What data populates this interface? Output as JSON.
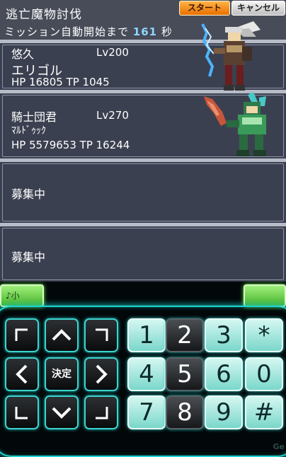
{
  "header": {
    "title": "逃亡魔物討伐",
    "countdown_prefix": "ミッション自動開始まで",
    "countdown_value": "161",
    "countdown_suffix": "秒",
    "start_label": "スタート",
    "cancel_label": "キャンセル"
  },
  "party": [
    {
      "team": "悠久",
      "name": "エリゴル",
      "level": "Lv200",
      "stats": "HP 16805  TP 1045"
    },
    {
      "team": "騎士団君",
      "name": "ﾏﾙﾄﾞｩｯｸ",
      "level": "Lv270",
      "stats": "HP 5579653  TP 16244"
    }
  ],
  "recruiting": [
    {
      "status": "募集中"
    },
    {
      "status": "募集中"
    }
  ],
  "tabs": {
    "left_label": "♪小",
    "right_label": ""
  },
  "dpad": {
    "center_label": "決定"
  },
  "keypad": [
    "1",
    "2",
    "3",
    "*",
    "4",
    "5",
    "6",
    "0",
    "7",
    "8",
    "9",
    "#"
  ],
  "watermark": "Ge",
  "colors": {
    "countdown": "#8fd6ff",
    "key_glow": "#1ed4cf",
    "start_button": "#f08a1a",
    "tab_green": "#6ed84a"
  }
}
